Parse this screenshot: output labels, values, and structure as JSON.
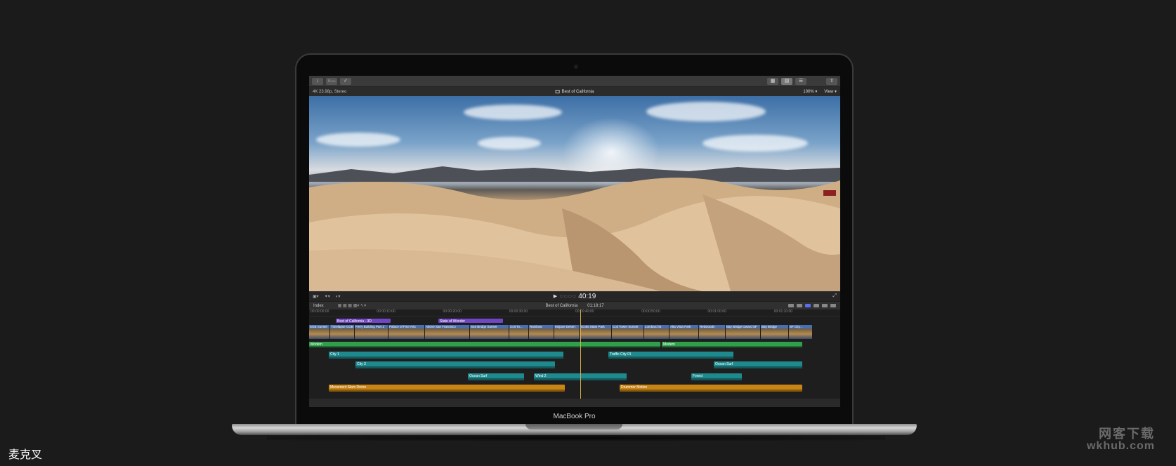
{
  "toolbar": {
    "left_icons": [
      "import-icon",
      "key-icon",
      "check-icon"
    ],
    "right_icons": [
      "grid-view-icon",
      "filmstrip-view-icon",
      "inspector-icon",
      "share-icon"
    ]
  },
  "viewer_header": {
    "format": "4K 23.98p, Stereo",
    "title": "Best of California",
    "zoom": "100%",
    "view_menu": "View"
  },
  "transport": {
    "timecode": "40:19"
  },
  "timeline_header": {
    "index": "Index",
    "project": "Best of California",
    "duration": "01:18:17"
  },
  "ruler": [
    "00:00:00:00",
    "00:00:10:00",
    "00:00:20:00",
    "00:00:30:00",
    "00:00:40:00",
    "00:00:50:00",
    "00:01:00:00",
    "00:01:10:00"
  ],
  "title_clips": [
    "Best of California - 3D",
    "State of Wonder"
  ],
  "video_clips": [
    "SGB Sunset",
    "Timelapse GGB",
    "Ferry Building Part 2",
    "Palace of Fine Arts",
    "Above San Francisco",
    "Sea Bridge Sunset",
    "Coit To...",
    "Rainbow",
    "Mojave Desert",
    "Scotts State Park",
    "Coit Tower Sunset",
    "Lombard St",
    "Alta Vista Park",
    "Redwoods",
    "Bay Bridge toward SF",
    "Bay Bridge",
    "SF City..."
  ],
  "music_clips": [
    "Modern",
    "Modern"
  ],
  "teal_clips": [
    "City 1",
    "Traffic City 01",
    "City 3",
    "Ocean Surf",
    "Ocean Surf",
    "Wind 2",
    "Forest"
  ],
  "orange_clips": [
    "Movement Slam Drone",
    "Drummer Motion"
  ],
  "bezel_label": "MacBook Pro",
  "caption_left": "麦克叉",
  "watermark": {
    "line1": "网客下载",
    "line2": "wkhub.com"
  }
}
